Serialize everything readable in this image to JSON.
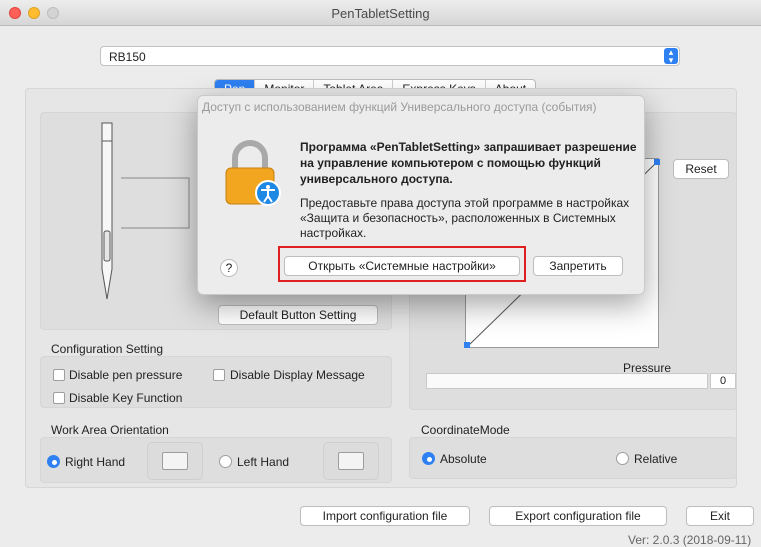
{
  "window": {
    "title": "PenTabletSetting"
  },
  "device": {
    "selected": "RB150"
  },
  "tabs": [
    "Pen",
    "Monitor",
    "Tablet Area",
    "Express Keys",
    "About"
  ],
  "active_tab": "Pen",
  "pen": {
    "default_button_label": "Default  Button Setting"
  },
  "pressure": {
    "reset_label": "Reset",
    "label": "Pressure",
    "value": "0"
  },
  "config": {
    "title": "Configuration Setting",
    "disable_pressure": "Disable pen pressure",
    "disable_display_message": "Disable Display Message",
    "disable_key": "Disable Key Function"
  },
  "orientation": {
    "title": "Work Area Orientation",
    "right_hand": "Right Hand",
    "left_hand": "Left Hand",
    "selected": "Right Hand"
  },
  "coordinate": {
    "title": "CoordinateMode",
    "absolute": "Absolute",
    "relative": "Relative",
    "selected": "Absolute"
  },
  "footer": {
    "import_label": "Import configuration file",
    "export_label": "Export configuration file",
    "exit_label": "Exit",
    "version": "Ver: 2.0.3 (2018-09-11)"
  },
  "dialog": {
    "title": "Доступ с использованием функций Универсального доступа (события)",
    "message_bold": "Программа «PenTabletSetting» запрашивает разрешение на управление компьютером с помощью функций универсального доступа.",
    "message": "Предоставьте права доступа этой программе в настройках «Защита и безопасность», расположенных в Системных настройках.",
    "help": "?",
    "open_label": "Открыть «Системные настройки»",
    "deny_label": "Запретить"
  },
  "colors": {
    "accent": "#2f80f3",
    "highlight": "#e02020",
    "close": "#fe5f57",
    "minimize": "#febc2e"
  }
}
